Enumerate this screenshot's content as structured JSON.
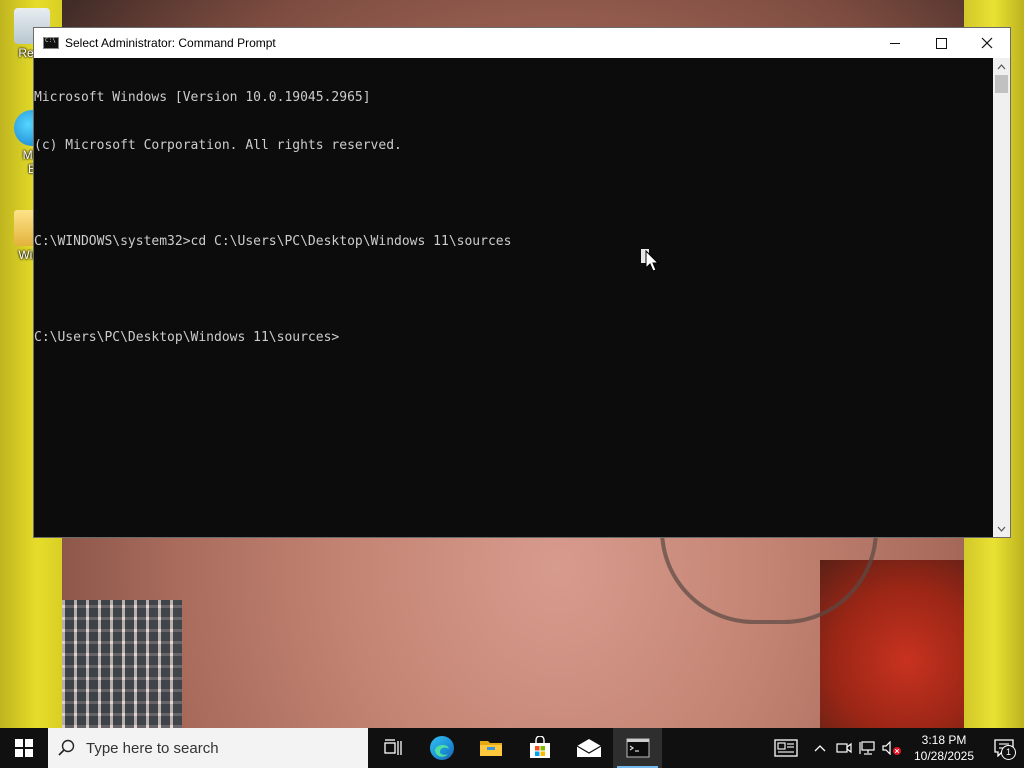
{
  "desktop": {
    "icons": [
      {
        "label": "Recy"
      },
      {
        "label": "Mic\nE"
      },
      {
        "label": "Wind"
      }
    ]
  },
  "window": {
    "title": "Select Administrator: Command Prompt",
    "console_lines": [
      "Microsoft Windows [Version 10.0.19045.2965]",
      "(c) Microsoft Corporation. All rights reserved.",
      "",
      "C:\\WINDOWS\\system32>cd C:\\Users\\PC\\Desktop\\Windows 11\\sources",
      "",
      "C:\\Users\\PC\\Desktop\\Windows 11\\sources>"
    ],
    "colors": {
      "console_bg": "#0c0c0c",
      "console_fg": "#cccccc",
      "titlebar_bg": "#ffffff"
    }
  },
  "taskbar": {
    "search_placeholder": "Type here to search",
    "apps": [
      {
        "name": "task-view",
        "icon": "task-view-icon"
      },
      {
        "name": "edge",
        "icon": "edge-icon"
      },
      {
        "name": "file-explorer",
        "icon": "folder-icon"
      },
      {
        "name": "store",
        "icon": "store-icon"
      },
      {
        "name": "mail",
        "icon": "mail-icon"
      },
      {
        "name": "command-prompt",
        "icon": "cmd-icon",
        "active": true
      }
    ],
    "clock": {
      "time": "3:18 PM",
      "date": "10/28/2025"
    },
    "notifications_count": "1",
    "accent": "#76b9ed"
  }
}
